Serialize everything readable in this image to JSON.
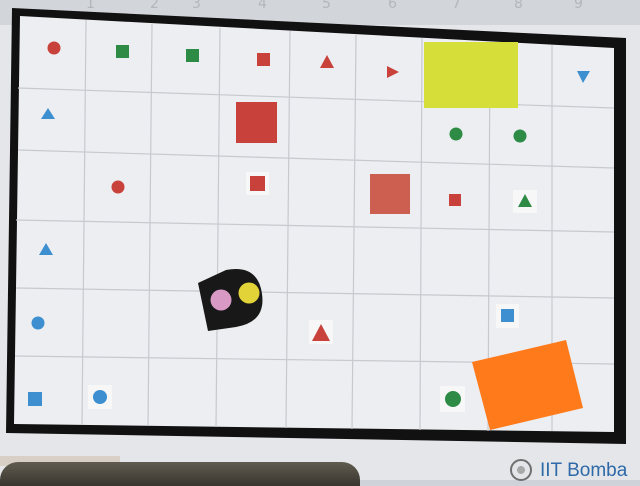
{
  "scene": {
    "description_colors": {
      "mat_background": "#e6e8ec",
      "border": "#111111",
      "grid_line": "#c9ccd1",
      "red": "#c8413a",
      "green": "#2e8b45",
      "blue": "#3d8fd0",
      "yellow_zone": "#d7e03a",
      "orange_zone": "#ff7a1a",
      "robot_body": "#1a1a1a",
      "robot_pink": "#d89ac4",
      "robot_yellow": "#e2d438"
    }
  },
  "column_labels": [
    "1",
    "2",
    "3",
    "4",
    "5",
    "6",
    "7",
    "8",
    "9"
  ],
  "branding": {
    "logo_text": "IIT Bomba"
  }
}
